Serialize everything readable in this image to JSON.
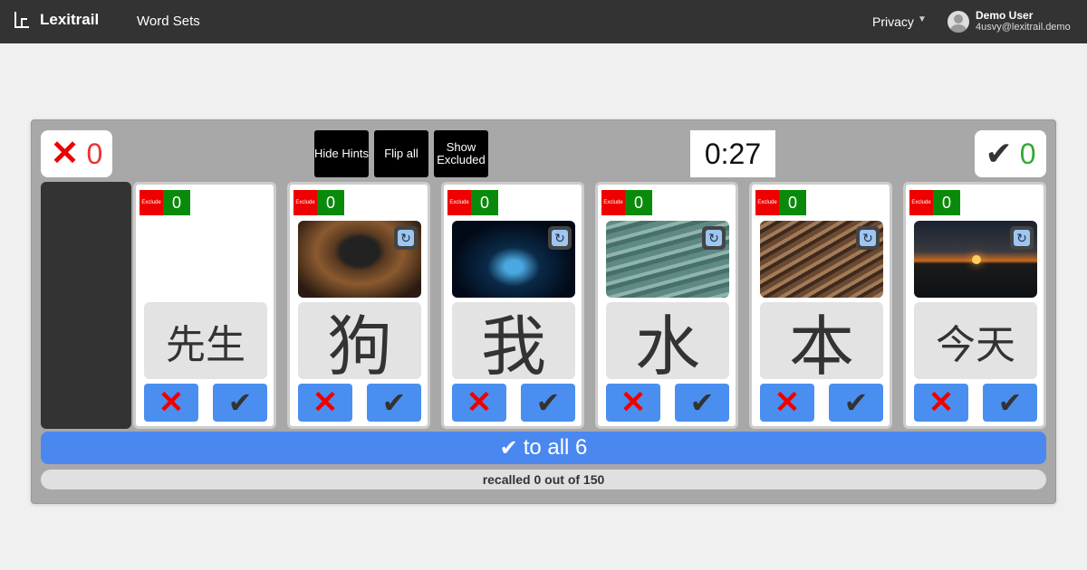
{
  "nav": {
    "brand": "Lexitrail",
    "word_sets": "Word Sets",
    "privacy": "Privacy",
    "user_name": "Demo User",
    "user_email": "4usvy@lexitrail.demo"
  },
  "scores": {
    "wrong_count": "0",
    "right_count": "0",
    "wrong_icon": "x-icon",
    "right_icon": "check-icon",
    "wrong_color": "#ee0000",
    "right_color": "#33aa33"
  },
  "controls": {
    "hide_hints": "Hide Hints",
    "flip_all": "Flip all",
    "show_excluded": "Show Excluded"
  },
  "timer": "0:27",
  "cards": [
    {
      "word": "先生",
      "count": "0",
      "exclude_label": "Exclude",
      "image": "none"
    },
    {
      "word": "狗",
      "count": "0",
      "exclude_label": "Exclude",
      "image": "dog-nose"
    },
    {
      "word": "我",
      "count": "0",
      "exclude_label": "Exclude",
      "image": "water-drop"
    },
    {
      "word": "水",
      "count": "0",
      "exclude_label": "Exclude",
      "image": "water-waves"
    },
    {
      "word": "本",
      "count": "0",
      "exclude_label": "Exclude",
      "image": "wood-grain"
    },
    {
      "word": "今天",
      "count": "0",
      "exclude_label": "Exclude",
      "image": "sunset"
    }
  ],
  "all_bar": {
    "text": "to all 6"
  },
  "progress": "recalled 0 out of 150",
  "colors": {
    "nav_bg": "#333333",
    "accent_blue": "#4a88f0",
    "exclude_red": "#ee0000",
    "count_green": "#0a8a0a"
  }
}
